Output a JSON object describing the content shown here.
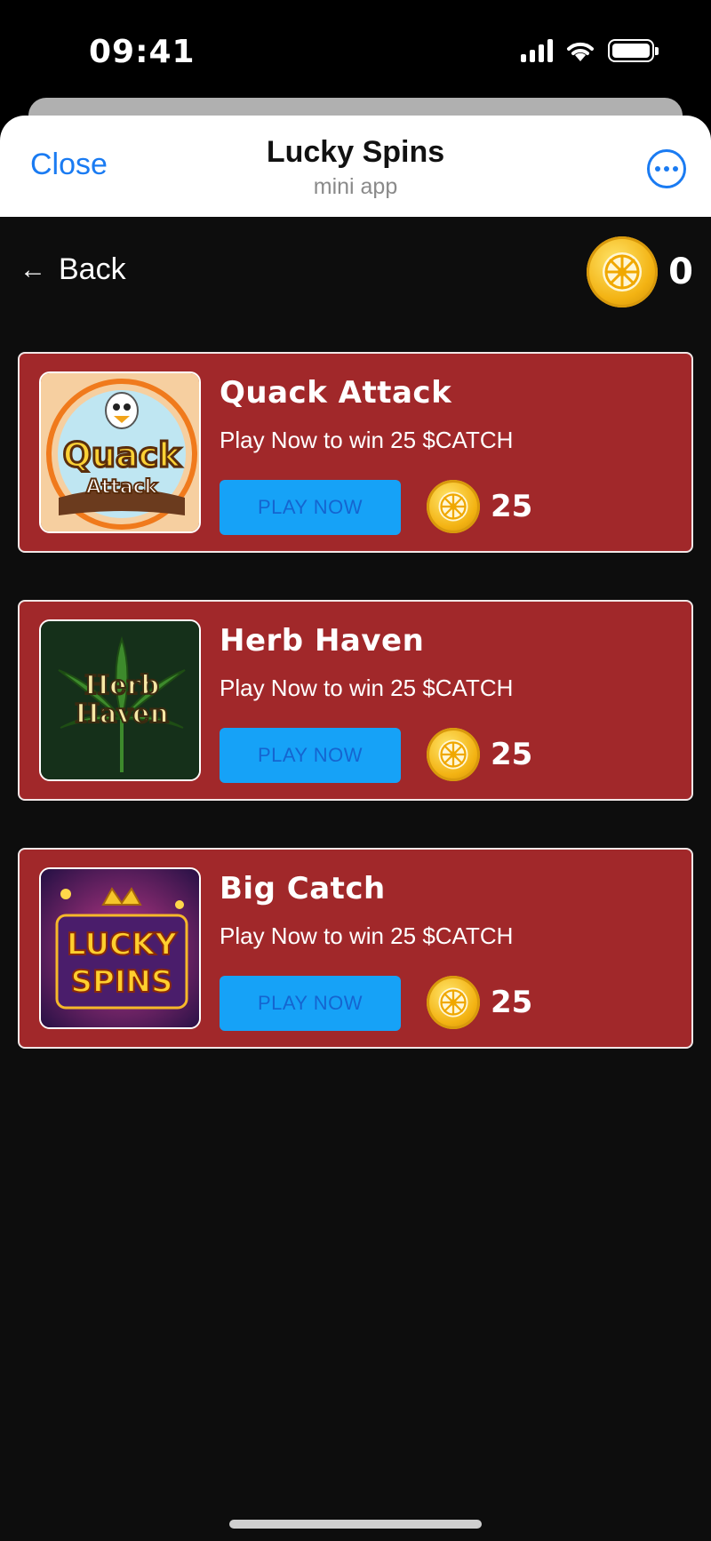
{
  "status_bar": {
    "time": "09:41"
  },
  "header": {
    "close_label": "Close",
    "title": "Lucky Spins",
    "subtitle": "mini app"
  },
  "nav": {
    "back_label": "Back"
  },
  "balance": {
    "value": "0"
  },
  "games": [
    {
      "title": "Quack Attack",
      "description": "Play Now to win 25 $CATCH",
      "button_label": "PLAY NOW",
      "reward": "25"
    },
    {
      "title": "Herb Haven",
      "description": "Play Now to win 25 $CATCH",
      "button_label": "PLAY NOW",
      "reward": "25"
    },
    {
      "title": "Big Catch",
      "description": "Play Now to win 25 $CATCH",
      "button_label": "PLAY NOW",
      "reward": "25"
    }
  ],
  "thumb_text": {
    "quack": [
      "Quack",
      "Attack"
    ],
    "herb": [
      "Herb",
      "Haven"
    ],
    "lucky": [
      "LUCKY",
      "SPINS"
    ]
  },
  "colors": {
    "accent": "#1a7bf2",
    "card_bg": "#a1282a",
    "play_button": "#16a2f7",
    "coin": "#f3b313"
  }
}
